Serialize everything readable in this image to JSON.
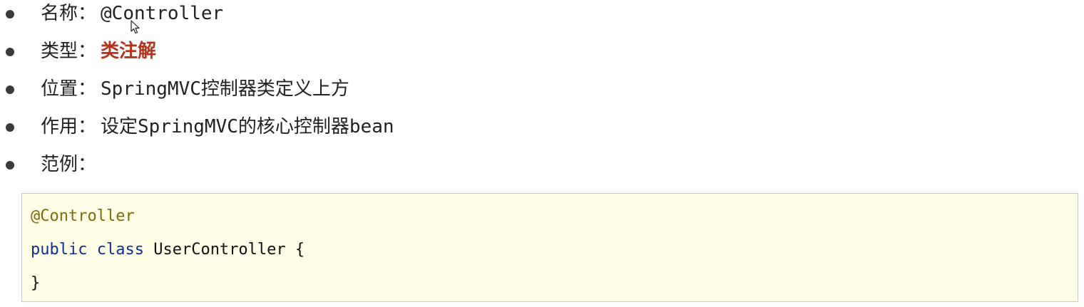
{
  "items": [
    {
      "label": "名称",
      "colon": "：",
      "value": "@Controller",
      "style": "mono"
    },
    {
      "label": "类型",
      "colon": "：",
      "value": "类注解",
      "style": "red-bold"
    },
    {
      "label": "位置",
      "colon": "：",
      "value": "SpringMVC控制器类定义上方",
      "style": "mono"
    },
    {
      "label": "作用",
      "colon": "：",
      "value": "设定SpringMVC的核心控制器bean",
      "style": "mono"
    },
    {
      "label": "范例",
      "colon": "：",
      "value": "",
      "style": "plain"
    }
  ],
  "code": {
    "annotation": "@Controller",
    "kw_public": "public",
    "kw_class": "class",
    "class_decl": "UserController {",
    "closing": "}"
  },
  "colors": {
    "accent_red": "#b5341d",
    "code_background": "#fffde6",
    "annotation_color": "#7d6a0c",
    "keyword_color": "#0d2f91"
  },
  "icons": {
    "bullet": "bullet-dot-icon",
    "cursor": "mouse-cursor-icon"
  }
}
